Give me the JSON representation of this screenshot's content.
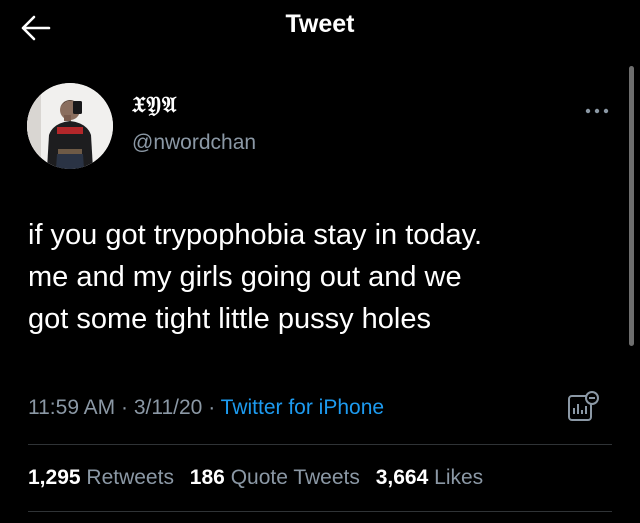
{
  "header": {
    "title": "Tweet"
  },
  "author": {
    "display_name": "𝔛𝔜𝔄",
    "handle": "@nwordchan"
  },
  "tweet": {
    "lines": [
      "if you got trypophobia stay in today.",
      "me and my girls going out and we",
      "got some tight little pussy holes"
    ],
    "time": "11:59 AM",
    "sep1": " · ",
    "date": "3/11/20",
    "sep2": " · ",
    "source": "Twitter for iPhone"
  },
  "stats": {
    "retweets_count": "1,295",
    "retweets_label": "Retweets",
    "quotes_count": "186",
    "quotes_label": "Quote Tweets",
    "likes_count": "3,664",
    "likes_label": "Likes"
  },
  "colors": {
    "background": "#000000",
    "text": "#e7e9ea",
    "secondary": "#8b98a5",
    "accent": "#1d9bf0",
    "divider": "#2f3336"
  },
  "icons": {
    "back": "arrow-left-icon",
    "more": "more-horizontal-icon",
    "analytics": "analytics-icon"
  }
}
